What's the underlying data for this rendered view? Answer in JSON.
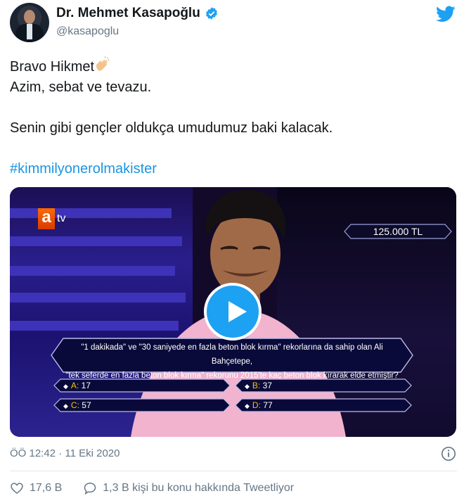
{
  "author": {
    "name": "Dr. Mehmet Kasapoğlu",
    "handle": "@kasapoglu"
  },
  "tweet": {
    "lines": [
      "Bravo Hikmet",
      "Azim, sebat ve tevazu.",
      "Senin gibi gençler oldukça umudumuz baki kalacak."
    ],
    "hashtag": "#kimmilyonerolmakister"
  },
  "media": {
    "channel_logo_letter": "a",
    "channel_logo_suffix": "tv",
    "prize": "125.000 TL",
    "question_line1": "\"1 dakikada\" ve \"30 saniyede en fazla beton blok kırma\" rekorlarına da sahip olan Ali Bahçetepe,",
    "question_line2": "\"tek seferde en fazla beton blok kırma\" rekorunu 2015'te kaç beton blok kırarak elde etmiştir?",
    "answers": [
      {
        "letter": "A:",
        "value": "17"
      },
      {
        "letter": "B:",
        "value": "37"
      },
      {
        "letter": "C:",
        "value": "57"
      },
      {
        "letter": "D:",
        "value": "77"
      }
    ],
    "play_icon": "play-icon"
  },
  "meta": {
    "timestamp": "ÖÖ 12:42 · 11 Eki 2020"
  },
  "actions": {
    "likes": "17,6 B",
    "replies_text": "1,3 B kişi bu konu hakkında Tweetliyor"
  },
  "colors": {
    "twitter_blue": "#1da1f2",
    "hashtag": "#1b95e0",
    "muted": "#657786",
    "answer_letter": "#f4c200"
  }
}
